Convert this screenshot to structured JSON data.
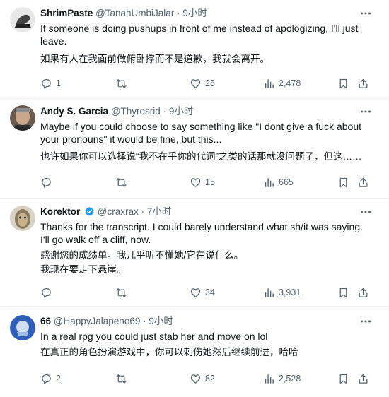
{
  "tweets": [
    {
      "name": "ShrimPaste",
      "handle": "@TanahUmbiJalar",
      "time": "9小时",
      "text": "If someone is doing pushups in front of me instead of apologizing, I'll just\nleave.",
      "translation": "如果有人在我面前做俯卧撑而不是道歉，我就会离开。",
      "replies": "1",
      "retweets": "",
      "likes": "28",
      "views": "2,478"
    },
    {
      "name": "Andy S. Garcia",
      "handle": "@Thyrosrid",
      "time": "9小时",
      "text": "Maybe if you could choose to say something like \"I dont give a fuck about\nyour pronouns\" it would be fine, but this...",
      "translation": "也许如果你可以选择说“我不在乎你的代词”之类的话那就没问题了，但这……",
      "replies": "",
      "retweets": "",
      "likes": "15",
      "views": "665"
    },
    {
      "name": "Korektor",
      "handle": "@craxrax",
      "time": "7小时",
      "text": "Thanks for the transcript. I could barely understand what sh/it was saying.\nI'll go walk off a cliff, now.",
      "translation": "感谢您的成绩单。我几乎听不懂她/它在说什么。\n我现在要走下悬崖。",
      "replies": "",
      "retweets": "",
      "likes": "34",
      "views": "3,931"
    },
    {
      "name": "66",
      "handle": "@HappyJalapeno69",
      "time": "9小时",
      "text": "In a real rpg you could just stab her and move on lol",
      "translation": "在真正的角色扮演游戏中，你可以刺伤她然后继续前进，哈哈",
      "replies": "2",
      "retweets": "",
      "likes": "82",
      "views": "2,528"
    }
  ],
  "icons": {
    "more": "more-icon",
    "reply": "reply-icon",
    "retweet": "retweet-icon",
    "like": "like-icon",
    "views": "views-icon",
    "bookmark": "bookmark-icon",
    "share": "share-icon",
    "verified": "verified-badge-icon"
  },
  "colors": {
    "text": "#0f1419",
    "secondary": "#536471",
    "verified": "#1d9bf0",
    "divider": "#eff3f4"
  }
}
